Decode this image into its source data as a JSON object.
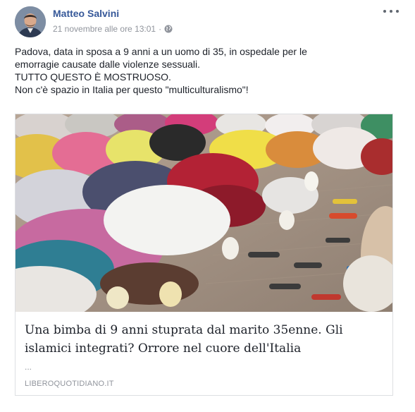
{
  "post": {
    "author": "Matteo Salvini",
    "timestamp": "21 novembre alle ore 13:01",
    "separator": "·",
    "privacy_icon": "globe-icon",
    "more_icon": "ellipsis-icon",
    "text_lines": [
      "Padova, data in sposa a 9 anni a un uomo di 35, in ospedale per le",
      "emorragie causate dalle violenze sessuali.",
      "TUTTO QUESTO È MOSTRUOSO.",
      "Non c'è spazio in Italia per questo \"multiculturalismo\"!"
    ]
  },
  "link_card": {
    "image_description": "photo-of-people-praying",
    "title_lines": [
      "Una bimba di 9 anni stuprata dal marito 35enne. Gli",
      "islamici integrati? Orrore nel cuore dell'Italia"
    ],
    "description": "...",
    "domain": "LIBEROQUOTIDIANO.IT"
  },
  "colors": {
    "author_link": "#365899",
    "meta_text": "#90949c",
    "body_text": "#1d2129",
    "card_border": "#dddfe2"
  }
}
